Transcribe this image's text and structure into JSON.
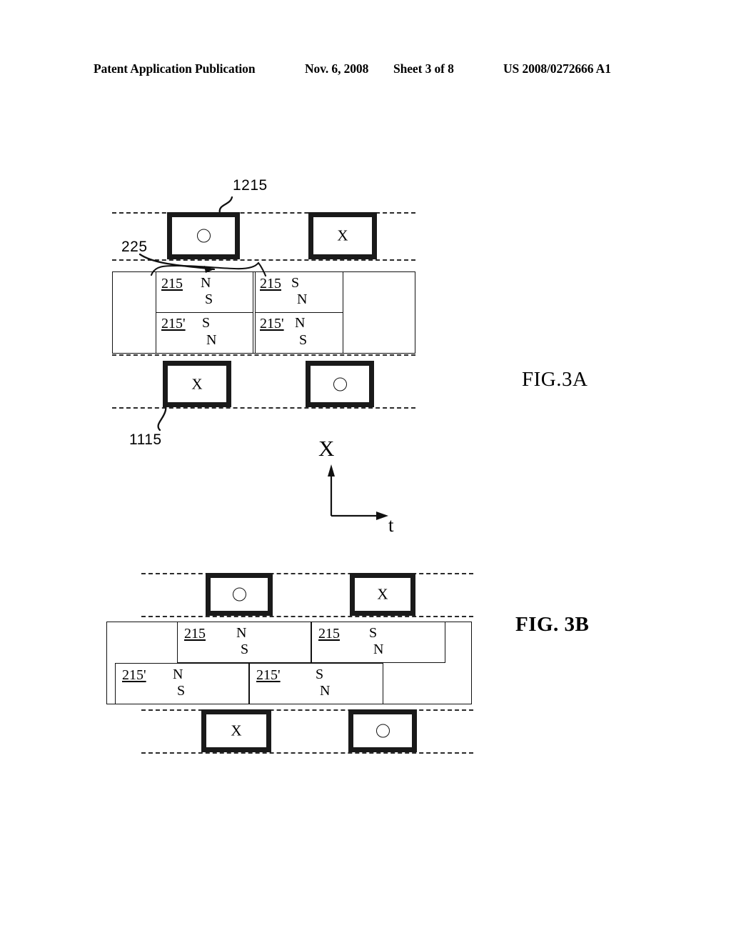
{
  "header": {
    "publication": "Patent Application Publication",
    "date": "Nov. 6, 2008",
    "sheet": "Sheet 3 of 8",
    "doc_number": "US 2008/0272666 A1"
  },
  "captions": {
    "fig_3a": "FIG.3A",
    "fig_3b": "FIG. 3B"
  },
  "callouts": {
    "coil_top": "1215",
    "magnet_array": "225",
    "coil_bottom": "1115"
  },
  "axis": {
    "vertical_label": "X",
    "horizontal_label": "t"
  },
  "glyphs": {
    "circle": "circle-mark",
    "cross": "X"
  },
  "fig_3a": {
    "coils_top": [
      {
        "name": "coil-top-left",
        "glyph": "circle"
      },
      {
        "name": "coil-top-right",
        "glyph": "X"
      }
    ],
    "coils_bottom": [
      {
        "name": "coil-bottom-left",
        "glyph": "X"
      },
      {
        "name": "coil-bottom-right",
        "glyph": "circle"
      }
    ],
    "magnets": [
      {
        "ref": "215",
        "pole_top": "N",
        "pole_bottom": "S",
        "row": "upper",
        "column": "left"
      },
      {
        "ref": "215",
        "pole_top": "S",
        "pole_bottom": "N",
        "row": "upper",
        "column": "right"
      },
      {
        "ref": "215'",
        "pole_top": "S",
        "pole_bottom": "N",
        "row": "lower",
        "column": "left"
      },
      {
        "ref": "215'",
        "pole_top": "N",
        "pole_bottom": "S",
        "row": "lower",
        "column": "right"
      }
    ]
  },
  "fig_3b": {
    "coils_top": [
      {
        "name": "coil-top-left",
        "glyph": "circle"
      },
      {
        "name": "coil-top-right",
        "glyph": "X"
      }
    ],
    "coils_bottom": [
      {
        "name": "coil-bottom-left",
        "glyph": "X"
      },
      {
        "name": "coil-bottom-right",
        "glyph": "circle"
      }
    ],
    "magnets": [
      {
        "ref": "215",
        "pole_top": "N",
        "pole_bottom": "S",
        "row": "upper",
        "column": "left"
      },
      {
        "ref": "215",
        "pole_top": "S",
        "pole_bottom": "N",
        "row": "upper",
        "column": "right"
      },
      {
        "ref": "215'",
        "pole_top": "N",
        "pole_bottom": "S",
        "row": "lower",
        "column": "left"
      },
      {
        "ref": "215'",
        "pole_top": "S",
        "pole_bottom": "N",
        "row": "lower",
        "column": "right"
      }
    ]
  },
  "colors": {
    "ink": "#111111",
    "dash": "#2a2a2a",
    "paper": "#ffffff"
  }
}
